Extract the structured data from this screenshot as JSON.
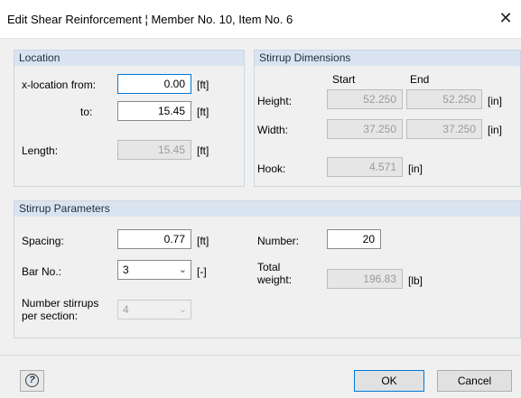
{
  "window": {
    "title": "Edit Shear Reinforcement ¦ Member No. 10, Item No. 6",
    "close_glyph": "✕"
  },
  "location": {
    "header": "Location",
    "x_from_label": "x-location from:",
    "x_from_value": "0.00",
    "x_from_unit": "[ft]",
    "to_label": "to:",
    "to_value": "15.45",
    "to_unit": "[ft]",
    "length_label": "Length:",
    "length_value": "15.45",
    "length_unit": "[ft]"
  },
  "stirrup_dimensions": {
    "header": "Stirrup Dimensions",
    "start_label": "Start",
    "end_label": "End",
    "height_label": "Height:",
    "height_start": "52.250",
    "height_end": "52.250",
    "height_unit": "[in]",
    "width_label": "Width:",
    "width_start": "37.250",
    "width_end": "37.250",
    "width_unit": "[in]",
    "hook_label": "Hook:",
    "hook_value": "4.571",
    "hook_unit": "[in]"
  },
  "stirrup_parameters": {
    "header": "Stirrup Parameters",
    "spacing_label": "Spacing:",
    "spacing_value": "0.77",
    "spacing_unit": "[ft]",
    "bar_label": "Bar No.:",
    "bar_value": "3",
    "bar_unit": "[-]",
    "per_section_label_1": "Number stirrups",
    "per_section_label_2": "per section:",
    "per_section_value": "4",
    "number_label": "Number:",
    "number_value": "20",
    "total_label_1": "Total",
    "total_label_2": "weight:",
    "total_value": "196.83",
    "total_unit": "[lb]"
  },
  "footer": {
    "help_icon": "help-icon",
    "ok_label": "OK",
    "cancel_label": "Cancel"
  }
}
